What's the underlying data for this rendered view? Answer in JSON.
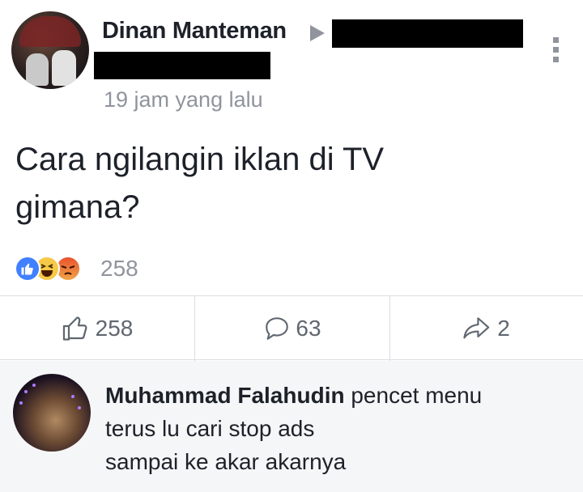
{
  "post": {
    "author": "Dinan Manteman",
    "timestamp": "19 jam yang lalu",
    "text_line1": "Cara ngilangin iklan di TV",
    "text_line2": "gimana?",
    "reaction_count": "258",
    "reaction_types": [
      "like-icon",
      "haha-icon",
      "angry-icon"
    ]
  },
  "actions": {
    "like_count": "258",
    "comment_count": "63",
    "share_count": "2"
  },
  "comment": {
    "author": "Muhammad Falahudin",
    "text_first": "pencet menu",
    "text_line2": "terus lu cari stop ads",
    "text_line3": "sampai ke akar akarnya"
  },
  "colors": {
    "accent": "#4080ff",
    "muted": "#90949c",
    "text": "#1d2129",
    "comment_bg": "#f5f6f7"
  }
}
